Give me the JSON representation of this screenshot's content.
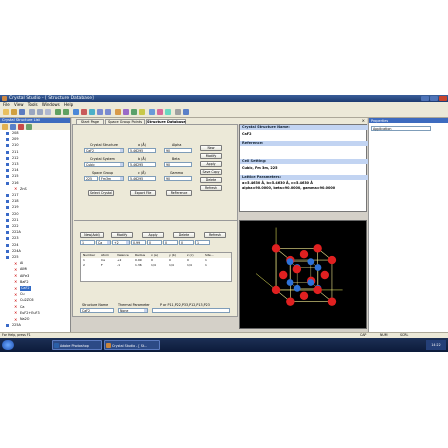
{
  "window": {
    "title": "Crystal Studio - [ Structure Database]"
  },
  "menu": [
    "File",
    "View",
    "Tools",
    "Windows",
    "Help"
  ],
  "left_panel": {
    "title": "Crystal Structure List",
    "items": [
      {
        "label": "208",
        "type": "node"
      },
      {
        "label": "209",
        "type": "node"
      },
      {
        "label": "210",
        "type": "node"
      },
      {
        "label": "211",
        "type": "node"
      },
      {
        "label": "212",
        "type": "node"
      },
      {
        "label": "213",
        "type": "node"
      },
      {
        "label": "214",
        "type": "node"
      },
      {
        "label": "215",
        "type": "node"
      },
      {
        "label": "216",
        "type": "node"
      },
      {
        "label": "ZnS",
        "type": "leaf"
      },
      {
        "label": "217",
        "type": "node"
      },
      {
        "label": "218",
        "type": "node"
      },
      {
        "label": "219",
        "type": "node"
      },
      {
        "label": "220",
        "type": "node"
      },
      {
        "label": "221",
        "type": "node"
      },
      {
        "label": "222",
        "type": "node"
      },
      {
        "label": "222A",
        "type": "node"
      },
      {
        "label": "223",
        "type": "node"
      },
      {
        "label": "224",
        "type": "node"
      },
      {
        "label": "224A",
        "type": "node"
      },
      {
        "label": "225",
        "type": "node"
      },
      {
        "label": "Al",
        "type": "leaf"
      },
      {
        "label": "AlMi",
        "type": "leaf"
      },
      {
        "label": "AlFe3",
        "type": "leaf"
      },
      {
        "label": "BaF2",
        "type": "leaf"
      },
      {
        "label": "CaF2",
        "type": "leaf",
        "selected": true
      },
      {
        "label": "Cu",
        "type": "leaf"
      },
      {
        "label": "Cu2ZC6",
        "type": "leaf"
      },
      {
        "label": "Ca",
        "type": "leaf"
      },
      {
        "label": "EuF2+EuF3",
        "type": "leaf"
      },
      {
        "label": "Na2O",
        "type": "leaf"
      },
      {
        "label": "225A",
        "type": "node"
      }
    ],
    "bottom_tabs": [
      "Struct..",
      "Crystal..",
      "Model.."
    ]
  },
  "tabs": [
    {
      "label": "Start Page",
      "active": false
    },
    {
      "label": "Space Group Points",
      "active": false
    },
    {
      "label": "Structure Database",
      "active": true
    }
  ],
  "form": {
    "crystal_structure_label": "Crystal Structure",
    "crystal_structure_value": "CaF2",
    "crystal_system_label": "Crystal System",
    "crystal_system_value": "Cubic",
    "space_group_label": "Space Group",
    "space_group_value": "225",
    "space_group_symbol": "Fm3m",
    "a_label": "a (Å)",
    "a_value": "5.46295",
    "b_label": "b (Å)",
    "b_value": "5.46295",
    "c_label": "c (Å)",
    "c_value": "5.46295",
    "alpha_label": "Alpha",
    "alpha_value": "90",
    "beta_label": "Beta",
    "beta_value": "90",
    "gamma_label": "Gamma",
    "gamma_value": "90",
    "buttons_right": [
      "New",
      "Modify",
      "Apply",
      "Save Copy",
      "Delete",
      "Refresh"
    ],
    "buttons_bottom": [
      "Select Crystal",
      "Export File",
      "ReFerence"
    ]
  },
  "atoms": {
    "buttons": [
      "New(Add)",
      "Modify",
      "Apply",
      "Delete",
      "Refresh"
    ],
    "edit_row": {
      "number": "1",
      "atom": "Ca",
      "valence": "+2",
      "radius": "0.99",
      "x": "0",
      "y": "0",
      "z": "0",
      "fraction": "1"
    },
    "columns": [
      "Number",
      "Atom",
      "Valence",
      "Radius",
      "x (a)",
      "y (b)",
      "z (c)",
      "Site..."
    ],
    "rows": [
      [
        "1",
        "Ca",
        "+2",
        "0.99",
        "0",
        "0",
        "0",
        "1"
      ],
      [
        "2",
        "F",
        "-1",
        "1.36",
        "1/4",
        "1/4",
        "1/4",
        "1"
      ]
    ],
    "structure_name_label": "Structure Name",
    "structure_name_value": "CaF2",
    "thermal_label": "Thermal Parameter",
    "thermal_value": "None",
    "params_text": "P or P11,P22,P33,P12,P13,P23"
  },
  "info": {
    "name_header": "Crystal Structure Name:",
    "name_value": "CaF2",
    "reference_header": "Reference:",
    "cell_header": "Cell Setting:",
    "cell_value": "Cubic, Fm 3m, 225",
    "lattice_header": "Lattice Parameters:",
    "lattice_line1": "a=5.4630 Å, b=5.4630 Å, c=5.4630 Å",
    "lattice_line2": "alpha=90.0000, beta=90.0000, gamma=90.0000"
  },
  "properties_panel": {
    "title": "Properties",
    "selector": "Application"
  },
  "status": {
    "left": "For Help, press F1",
    "right_items": [
      "CAP",
      "NUM",
      "SCRL"
    ]
  },
  "taskbar": {
    "items": [
      {
        "label": "Adobe Photoshop",
        "color": "#2a5fa8"
      },
      {
        "label": "Crystal Studio - [ St...",
        "color": "#c8843c"
      }
    ],
    "clock": "14:22"
  },
  "colors": {
    "calcium": "#2e72d8",
    "fluorine": "#e02020",
    "bonds": "#f0e68c",
    "titlebar": "#1d3b70"
  }
}
